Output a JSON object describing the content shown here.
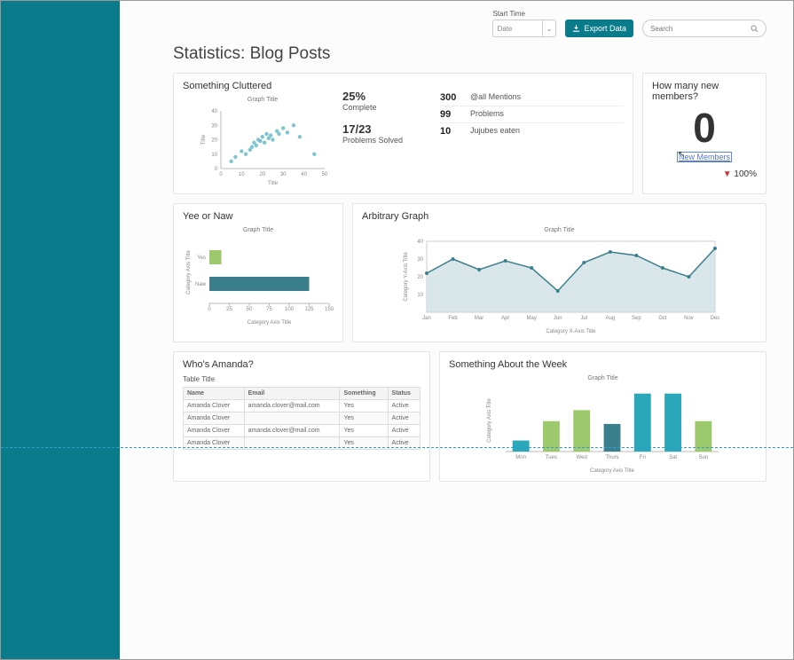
{
  "toolbar": {
    "start_time_label": "Start Time",
    "date_placeholder": "Date",
    "export_label": "Export Data",
    "search_placeholder": "Search"
  },
  "page_title": "Statistics: Blog Posts",
  "cluttered": {
    "title": "Something Cluttered",
    "graph_title": "Graph Title",
    "complete_pct": "25%",
    "complete_label": "Complete",
    "solved_value": "17/23",
    "solved_label": "Problems Solved",
    "rows": [
      {
        "n": "300",
        "label": "@all Mentions"
      },
      {
        "n": "99",
        "label": "Problems"
      },
      {
        "n": "10",
        "label": "Jujubes eaten"
      }
    ]
  },
  "members": {
    "title": "How many new members?",
    "value": "0",
    "link": "New Members",
    "pct": "100%"
  },
  "yee": {
    "title": "Yee or Naw",
    "graph_title": "Graph Title",
    "y_axis": "Category Axis Title",
    "x_axis": "Category Axis Title"
  },
  "arbitrary": {
    "title": "Arbitrary Graph",
    "graph_title": "Graph Title",
    "y_axis": "Category Y-Axis Title",
    "x_axis": "Category X-Axis Title"
  },
  "amanda": {
    "title": "Who's Amanda?",
    "table_title": "Table Title",
    "headers": [
      "Name",
      "Email",
      "Something",
      "Status"
    ]
  },
  "week": {
    "title": "Something About the Week",
    "graph_title": "Graph Title",
    "y_axis": "Category Axis Title",
    "x_axis": "Category Axis Title"
  },
  "chart_data": [
    {
      "id": "cluttered_scatter",
      "type": "scatter",
      "title": "Graph Title",
      "xlim": [
        0,
        50
      ],
      "ylim": [
        0,
        40
      ],
      "xticks": [
        0,
        10,
        20,
        30,
        40,
        50
      ],
      "yticks": [
        0,
        10,
        20,
        30,
        40
      ],
      "points": [
        [
          5,
          5
        ],
        [
          7,
          8
        ],
        [
          10,
          12
        ],
        [
          12,
          10
        ],
        [
          14,
          13
        ],
        [
          15,
          15
        ],
        [
          16,
          18
        ],
        [
          17,
          16
        ],
        [
          18,
          20
        ],
        [
          19,
          19
        ],
        [
          20,
          22
        ],
        [
          21,
          18
        ],
        [
          22,
          24
        ],
        [
          23,
          21
        ],
        [
          24,
          23
        ],
        [
          25,
          20
        ],
        [
          27,
          26
        ],
        [
          28,
          24
        ],
        [
          30,
          28
        ],
        [
          32,
          25
        ],
        [
          35,
          30
        ],
        [
          38,
          22
        ],
        [
          45,
          10
        ]
      ]
    },
    {
      "id": "yee_bar",
      "type": "bar-horizontal",
      "title": "Graph Title",
      "categories": [
        "Yes",
        "Naw"
      ],
      "values": [
        15,
        125
      ],
      "xlim": [
        0,
        150
      ],
      "xticks": [
        0,
        25,
        50,
        75,
        100,
        125,
        150
      ],
      "colors": [
        "#9cc96b",
        "#3c7f8c"
      ]
    },
    {
      "id": "arbitrary_line",
      "type": "area",
      "title": "Graph Title",
      "ylim": [
        0,
        40
      ],
      "yticks": [
        10,
        20,
        30,
        40
      ],
      "categories": [
        "Jan",
        "Feb",
        "Mar",
        "Apr",
        "May",
        "Jun",
        "Jul",
        "Aug",
        "Sep",
        "Oct",
        "Nov",
        "Dec"
      ],
      "values": [
        22,
        30,
        24,
        29,
        25,
        12,
        28,
        34,
        32,
        25,
        20,
        36
      ]
    },
    {
      "id": "amanda_table",
      "type": "table",
      "headers": [
        "Name",
        "Email",
        "Something",
        "Status"
      ],
      "rows": [
        [
          "Amanda Clover",
          "amanda.clover@mail.com",
          "Yes",
          "Active"
        ],
        [
          "Amanda Clover",
          "",
          "Yes",
          "Active"
        ],
        [
          "Amanda Clover",
          "amanda.clover@mail.com",
          "Yes",
          "Active"
        ],
        [
          "Amanda Clover",
          "",
          "Yes",
          "Active"
        ]
      ]
    },
    {
      "id": "week_bar",
      "type": "bar",
      "title": "Graph Title",
      "categories": [
        "Mon",
        "Tues",
        "Wed",
        "Thurs",
        "Fri",
        "Sat",
        "Sun"
      ],
      "values": [
        8,
        22,
        30,
        20,
        42,
        42,
        22
      ],
      "colors": [
        "#2aa7b8",
        "#9cc96b",
        "#9cc96b",
        "#3c7f8c",
        "#2aa7b8",
        "#2aa7b8",
        "#9cc96b"
      ],
      "ylim": [
        0,
        45
      ]
    }
  ]
}
